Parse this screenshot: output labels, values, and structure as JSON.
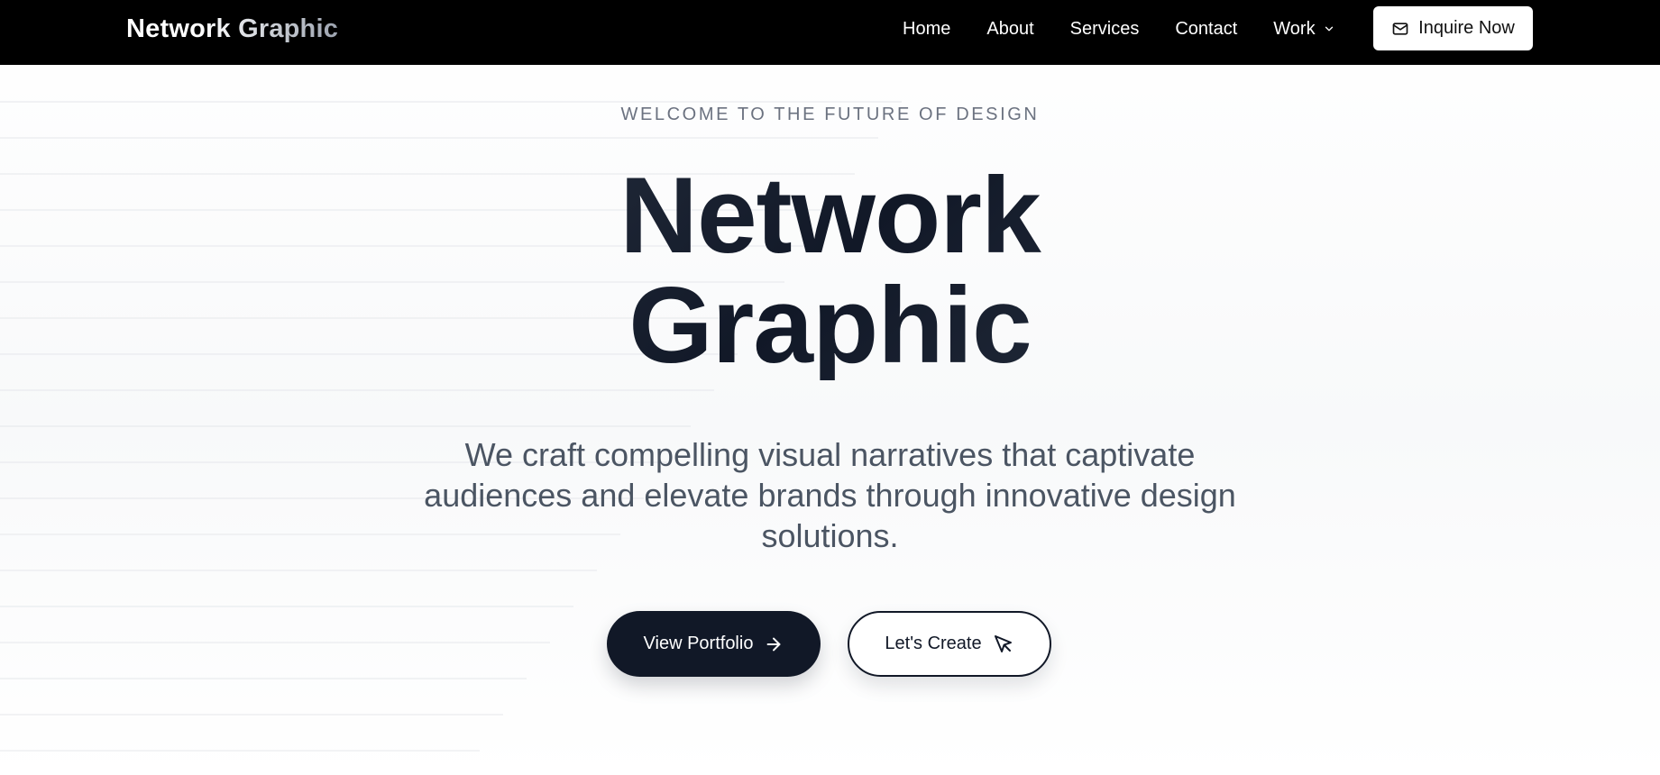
{
  "nav": {
    "brand": "Network Graphic",
    "links": [
      "Home",
      "About",
      "Services",
      "Contact"
    ],
    "work_label": "Work",
    "cta_label": "Inquire Now",
    "icons": {
      "cta": "mail-icon",
      "work": "chevron-down-icon"
    }
  },
  "hero": {
    "eyebrow": "WELCOME TO THE FUTURE OF DESIGN",
    "title_line1": "Network",
    "title_line2": "Graphic",
    "subtitle": "We craft compelling visual narratives that captivate audiences and elevate brands through innovative design solutions.",
    "primary_button": "View Portfolio",
    "secondary_button": "Let's Create",
    "icons": {
      "primary": "arrow-right-icon",
      "secondary": "mouse-pointer-icon"
    }
  },
  "colors": {
    "nav_background": "#000000",
    "accent_dark": "#111827",
    "text_muted": "#6b7280"
  }
}
